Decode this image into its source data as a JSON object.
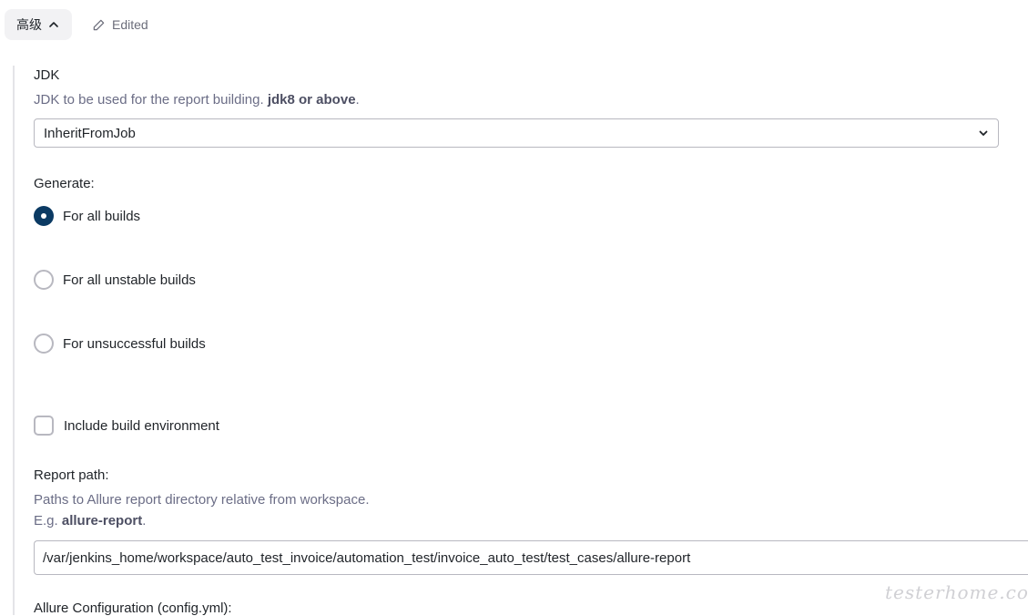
{
  "advanced": {
    "label": "高级",
    "edited_label": "Edited"
  },
  "jdk": {
    "label": "JDK",
    "help_prefix": "JDK to be used for the report building. ",
    "help_bold": "jdk8 or above",
    "help_suffix": ".",
    "selected": "InheritFromJob"
  },
  "generate": {
    "label": "Generate:",
    "options": [
      {
        "label": "For all builds",
        "checked": true
      },
      {
        "label": "For all unstable builds",
        "checked": false
      },
      {
        "label": "For unsuccessful builds",
        "checked": false
      }
    ]
  },
  "include_env": {
    "label": "Include build environment",
    "checked": false
  },
  "report_path": {
    "label": "Report path:",
    "help_line1": "Paths to Allure report directory relative from workspace.",
    "help_line2_prefix": "E.g. ",
    "help_line2_bold": "allure-report",
    "help_line2_suffix": ".",
    "value": "/var/jenkins_home/workspace/auto_test_invoice/automation_test/invoice_auto_test/test_cases/allure-report"
  },
  "allure_config": {
    "label": "Allure Configuration (config.yml):"
  },
  "watermark": "testerhome.com",
  "colors": {
    "accent": "#0b3a63",
    "help_text": "#6b6d86",
    "border": "#b8b8c0"
  }
}
